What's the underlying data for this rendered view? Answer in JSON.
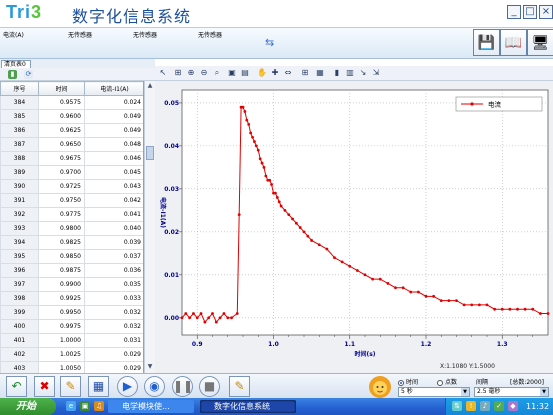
{
  "app": {
    "logo": "Tri3",
    "title": "数字化信息系统",
    "window_buttons": [
      "_",
      "□",
      "×"
    ]
  },
  "sensors": [
    {
      "label": "电流(A)"
    },
    {
      "label": "无传感器"
    },
    {
      "label": "无传感器"
    },
    {
      "label": "无传感器"
    }
  ],
  "left_panel": {
    "tab": "清页表0",
    "columns": [
      "序号",
      "时间",
      "电流-I1(A)"
    ],
    "rows": [
      [
        "384",
        "0.9575",
        "0.024"
      ],
      [
        "385",
        "0.9600",
        "0.049"
      ],
      [
        "386",
        "0.9625",
        "0.049"
      ],
      [
        "387",
        "0.9650",
        "0.048"
      ],
      [
        "388",
        "0.9675",
        "0.046"
      ],
      [
        "389",
        "0.9700",
        "0.045"
      ],
      [
        "390",
        "0.9725",
        "0.043"
      ],
      [
        "391",
        "0.9750",
        "0.042"
      ],
      [
        "392",
        "0.9775",
        "0.041"
      ],
      [
        "393",
        "0.9800",
        "0.040"
      ],
      [
        "394",
        "0.9825",
        "0.039"
      ],
      [
        "395",
        "0.9850",
        "0.037"
      ],
      [
        "396",
        "0.9875",
        "0.036"
      ],
      [
        "397",
        "0.9900",
        "0.035"
      ],
      [
        "398",
        "0.9925",
        "0.033"
      ],
      [
        "399",
        "0.9950",
        "0.032"
      ],
      [
        "400",
        "0.9975",
        "0.032"
      ],
      [
        "401",
        "1.0000",
        "0.031"
      ],
      [
        "402",
        "1.0025",
        "0.029"
      ],
      [
        "403",
        "1.0050",
        "0.029"
      ],
      [
        "404",
        "1.0075",
        "0.028"
      ]
    ]
  },
  "chart_data": {
    "type": "line",
    "title": "",
    "xlabel": "时间(s)",
    "ylabel": "电流-I1(A)",
    "xlim": [
      0.88,
      1.36
    ],
    "ylim": [
      -0.004,
      0.053
    ],
    "x_ticks": [
      "0.9",
      "1.0",
      "1.1",
      "1.2",
      "1.3"
    ],
    "y_ticks": [
      "0.00",
      "0.01",
      "0.02",
      "0.03",
      "0.04",
      "0.05"
    ],
    "legend": "top-right",
    "grid": true,
    "color": "#e00000",
    "series": [
      {
        "name": "电流",
        "x": [
          0.88,
          0.885,
          0.89,
          0.895,
          0.9,
          0.905,
          0.91,
          0.915,
          0.92,
          0.925,
          0.93,
          0.935,
          0.94,
          0.945,
          0.9525,
          0.955,
          0.9575,
          0.96,
          0.9625,
          0.965,
          0.9675,
          0.97,
          0.9725,
          0.975,
          0.9775,
          0.98,
          0.9825,
          0.985,
          0.9875,
          0.99,
          0.9925,
          0.995,
          0.9975,
          1.0,
          1.0025,
          1.005,
          1.0075,
          1.01,
          1.015,
          1.02,
          1.025,
          1.03,
          1.035,
          1.04,
          1.045,
          1.05,
          1.06,
          1.07,
          1.08,
          1.09,
          1.1,
          1.11,
          1.12,
          1.13,
          1.14,
          1.15,
          1.16,
          1.17,
          1.18,
          1.19,
          1.2,
          1.21,
          1.22,
          1.23,
          1.24,
          1.25,
          1.26,
          1.27,
          1.28,
          1.29,
          1.3,
          1.31,
          1.32,
          1.33,
          1.34,
          1.35,
          1.36
        ],
        "y": [
          0.0,
          0.001,
          0.0,
          0.001,
          0.0,
          0.001,
          -0.001,
          0.0,
          0.001,
          -0.001,
          0.0,
          0.001,
          0.0,
          0.0,
          0.001,
          0.024,
          0.049,
          0.049,
          0.048,
          0.046,
          0.045,
          0.043,
          0.042,
          0.041,
          0.04,
          0.039,
          0.037,
          0.036,
          0.035,
          0.033,
          0.032,
          0.032,
          0.031,
          0.029,
          0.029,
          0.028,
          0.027,
          0.026,
          0.025,
          0.024,
          0.023,
          0.022,
          0.021,
          0.02,
          0.019,
          0.018,
          0.017,
          0.016,
          0.014,
          0.013,
          0.012,
          0.011,
          0.01,
          0.009,
          0.009,
          0.008,
          0.007,
          0.007,
          0.006,
          0.006,
          0.005,
          0.005,
          0.004,
          0.004,
          0.004,
          0.003,
          0.003,
          0.003,
          0.003,
          0.002,
          0.002,
          0.002,
          0.002,
          0.002,
          0.002,
          0.001,
          0.001
        ]
      }
    ]
  },
  "status": {
    "cursor": "X:1.1080  Y:1.5000"
  },
  "bottom": {
    "radio_time": "时间",
    "radio_points": "点数",
    "interval_label": "间隔",
    "total_label": "[总数:2000]",
    "time_value": "5 秒",
    "interval_value": "2.5 毫秒"
  },
  "taskbar": {
    "start": "开始",
    "tasks": [
      "电学模块使...",
      "数字化信息系统"
    ],
    "clock": "11:32"
  }
}
